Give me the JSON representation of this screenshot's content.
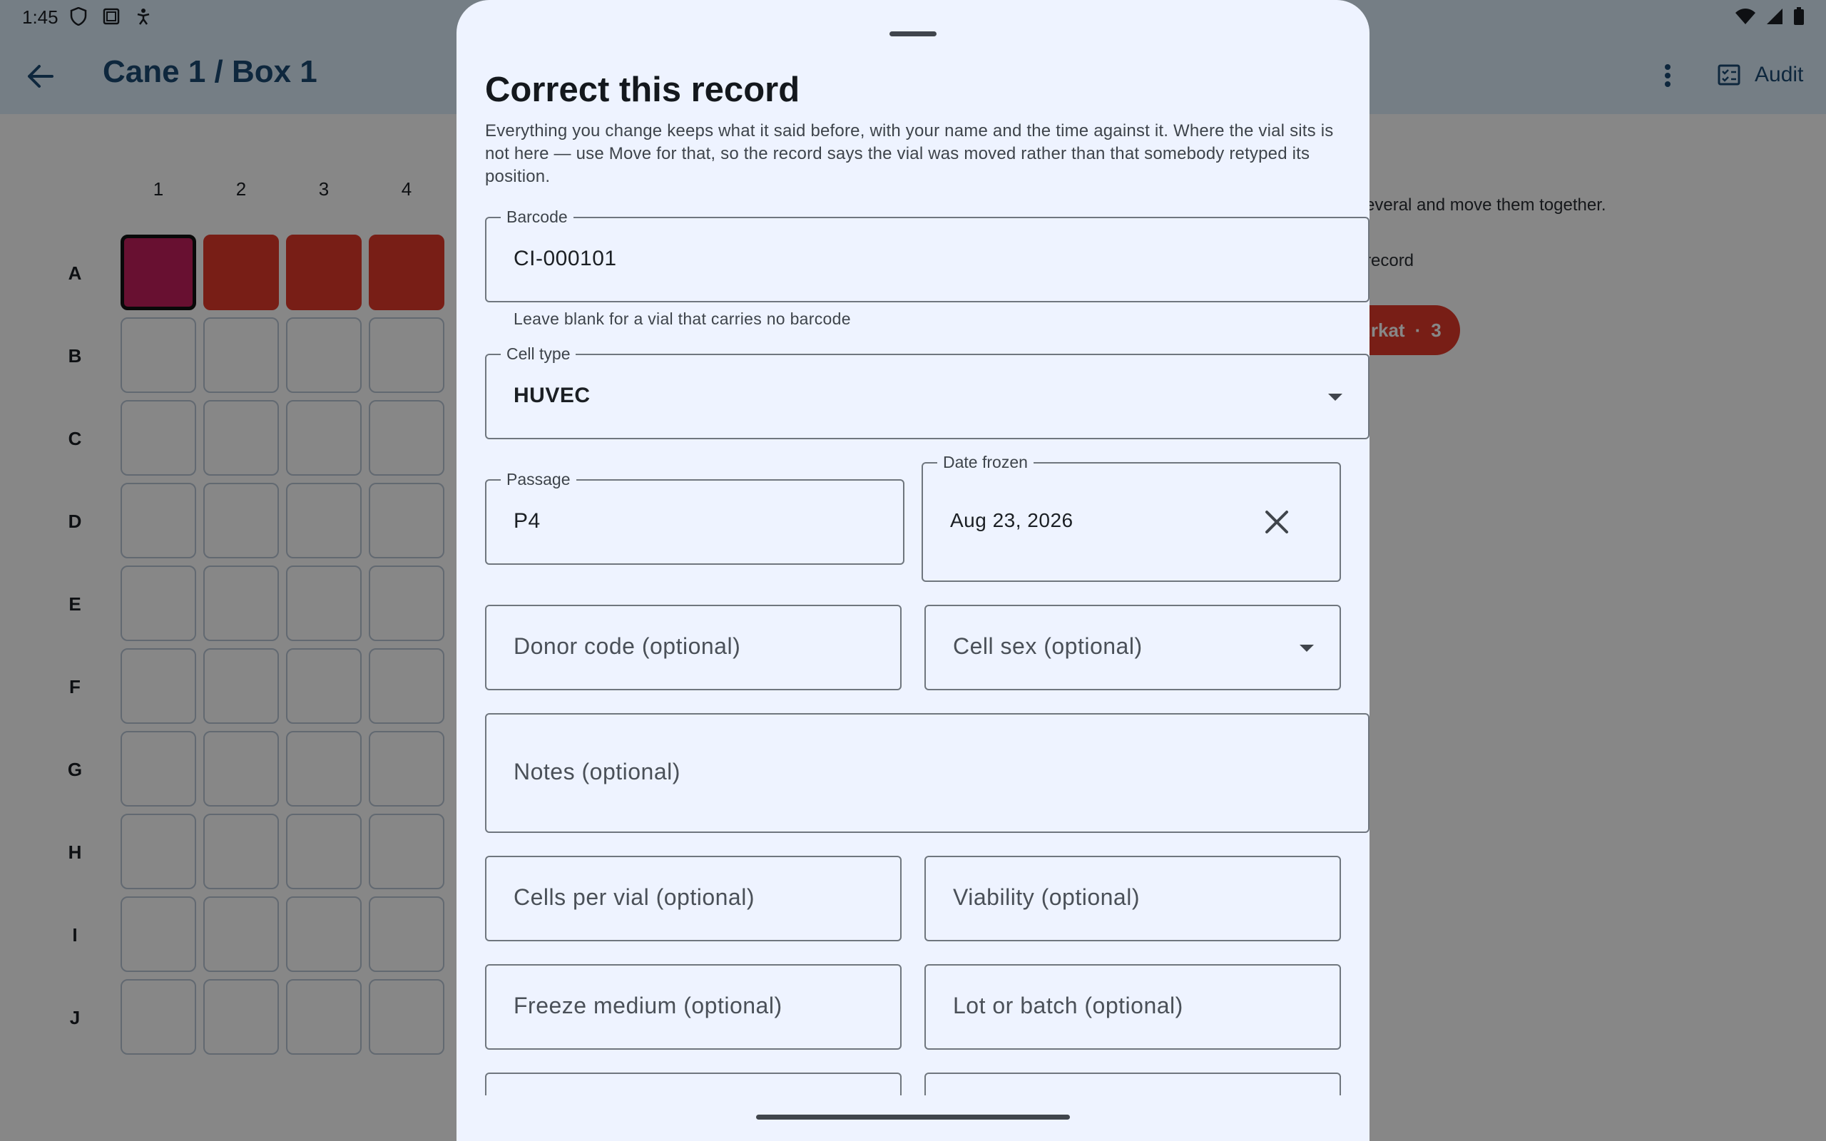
{
  "status_bar": {
    "time": "1:45"
  },
  "app_bar": {
    "title": "Cane 1 / Box 1",
    "audit_label": "Audit"
  },
  "grid": {
    "columns": [
      "1",
      "2",
      "3",
      "4"
    ],
    "rows": [
      "A",
      "B",
      "C",
      "D",
      "E",
      "F",
      "G",
      "H",
      "I",
      "J"
    ]
  },
  "background_panel": {
    "hint_text": "everal and move them together.",
    "record_text": "record",
    "chip_label": "urkat",
    "chip_sep": "·",
    "chip_count": "3"
  },
  "sheet": {
    "title": "Correct this record",
    "description": "Everything you change keeps what it said before, with your name and the time against it. Where the vial sits is not here — use Move for that, so the record says the vial was moved rather than that somebody retyped its position.",
    "barcode": {
      "label": "Barcode",
      "value": "CI-000101",
      "helper": "Leave blank for a vial that carries no barcode"
    },
    "cell_type": {
      "label": "Cell type",
      "value": "HUVEC"
    },
    "passage": {
      "label": "Passage",
      "value": "P4"
    },
    "date_frozen": {
      "label": "Date frozen",
      "value": "Aug 23, 2026"
    },
    "donor_code": {
      "placeholder": "Donor code (optional)"
    },
    "cell_sex": {
      "placeholder": "Cell sex (optional)"
    },
    "notes": {
      "placeholder": "Notes (optional)"
    },
    "cells_per_vial": {
      "placeholder": "Cells per vial (optional)"
    },
    "viability": {
      "placeholder": "Viability (optional)"
    },
    "freeze_medium": {
      "placeholder": "Freeze medium (optional)"
    },
    "lot_batch": {
      "placeholder": "Lot or batch (optional)"
    }
  },
  "colors": {
    "vial_filled": "#e23a2a",
    "vial_selected": "#c41f5e",
    "app_bar": "#ddeefb",
    "sheet_bg": "#eef3ff"
  },
  "icons": [
    "shield-icon",
    "screenshot-icon",
    "accessibility-icon",
    "wifi-icon",
    "signal-icon",
    "battery-icon",
    "back-arrow-icon",
    "more-vert-icon",
    "audit-icon",
    "dropdown-arrow-icon",
    "close-icon"
  ]
}
